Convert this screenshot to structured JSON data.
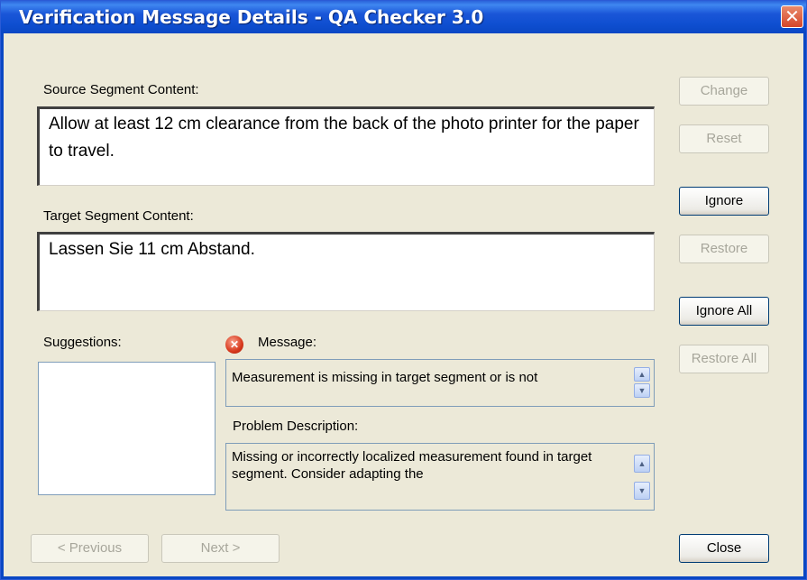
{
  "window": {
    "title": "Verification Message Details - QA Checker 3.0",
    "close_glyph": "✕"
  },
  "source": {
    "label": "Source Segment Content:",
    "text": "Allow at least 12 cm clearance from the back of the photo printer for the paper to travel."
  },
  "target": {
    "label": "Target Segment Content:",
    "text": "Lassen Sie 11 cm Abstand."
  },
  "suggestions": {
    "label": "Suggestions:"
  },
  "message": {
    "label": "Message:",
    "text": "Measurement is missing in target segment or is not"
  },
  "problem": {
    "label": "Problem Description:",
    "text": "Missing or incorrectly localized measurement found in target segment. Consider adapting the"
  },
  "buttons": {
    "change": "Change",
    "reset": "Reset",
    "ignore": "Ignore",
    "restore": "Restore",
    "ignore_all": "Ignore All",
    "restore_all": "Restore All",
    "previous": "< Previous",
    "next": "Next >",
    "close": "Close"
  },
  "icons": {
    "error": "error-icon",
    "scroll_up": "▲",
    "scroll_down": "▼"
  }
}
